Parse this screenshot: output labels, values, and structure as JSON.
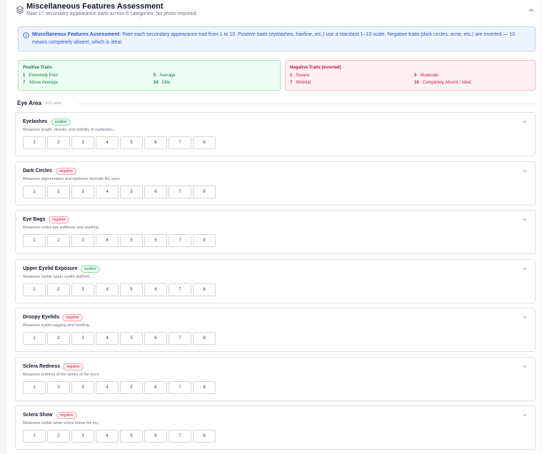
{
  "header": {
    "title": "Miscellaneous Features Assessment",
    "subtitle": "Rate 17 secondary appearance traits across 6 categories. No photo required.",
    "icon": "layers-icon",
    "collapse_icon": "chevron-up-icon"
  },
  "info": {
    "icon": "info-icon",
    "label": "Miscellaneous Features Assessment:",
    "text": "Rate each secondary appearance trait from 1 to 10. Positive traits (eyelashes, hairline, etc.) use a standard 1–10 scale. Negative traits (dark circles, acne, etc.) are inverted — 10 means completely absent, which is ideal."
  },
  "legend": {
    "positive": {
      "title": "Positive Traits",
      "items": [
        {
          "n": "1",
          "label": "Extremely Poor"
        },
        {
          "n": "5",
          "label": "Average"
        },
        {
          "n": "7",
          "label": "Above Average"
        },
        {
          "n": "10",
          "label": "Elite"
        }
      ]
    },
    "negative": {
      "title": "Negative Traits (inverted)",
      "items": [
        {
          "n": "1",
          "label": "Severe"
        },
        {
          "n": "5",
          "label": "Moderate"
        },
        {
          "n": "7",
          "label": "Minimal"
        },
        {
          "n": "10",
          "label": "Completely Absent / Ideal"
        }
      ]
    }
  },
  "section": {
    "title": "Eye Area",
    "rated": "0/10 rated"
  },
  "scale": [
    "1",
    "2",
    "3",
    "4",
    "5",
    "6",
    "7",
    "8"
  ],
  "traits": [
    {
      "name": "Eyelashes",
      "type": "positive",
      "description": "Measures length, density, and visibility of eyelashes."
    },
    {
      "name": "Dark Circles",
      "type": "negative",
      "description": "Measures pigmentation and darkness beneath the eyes."
    },
    {
      "name": "Eye Bags",
      "type": "negative",
      "description": "Measures under-eye puffiness and swelling."
    },
    {
      "name": "Upper Eyelid Exposure",
      "type": "positive",
      "description": "Measures visible upper eyelid platform."
    },
    {
      "name": "Droopy Eyelids",
      "type": "negative",
      "description": "Measures eyelid sagging and hooding."
    },
    {
      "name": "Sclera Redness",
      "type": "negative",
      "description": "Measures redness of the whites of the eyes."
    },
    {
      "name": "Sclera Show",
      "type": "negative",
      "description": "Measures visible white sclera below the iris."
    }
  ],
  "colors": {
    "accent": "#2f55c8",
    "positive": "#15803d",
    "negative": "#c81e44"
  }
}
